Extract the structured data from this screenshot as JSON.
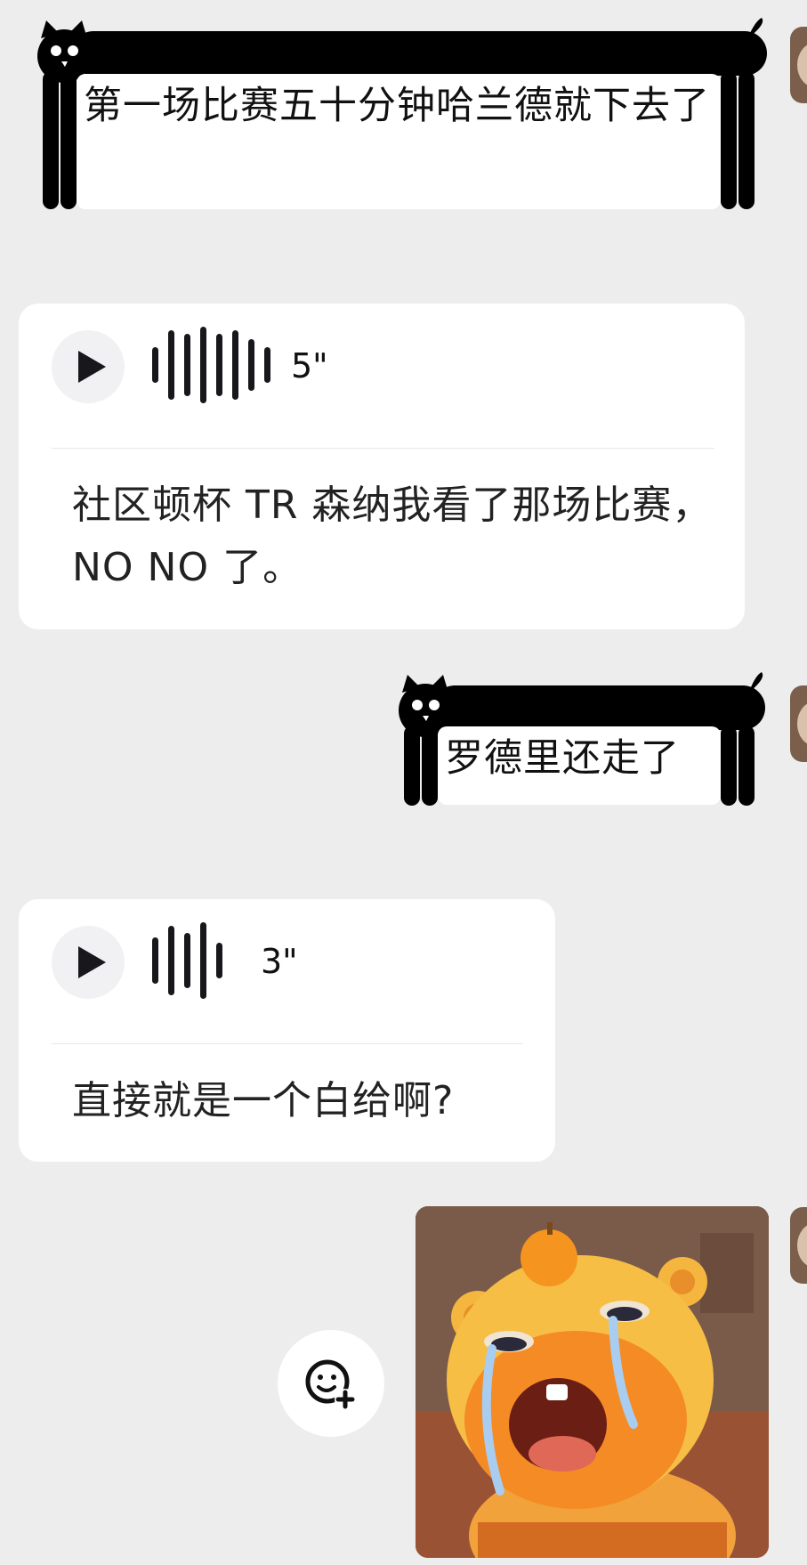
{
  "messages": [
    {
      "side": "right",
      "kind": "text",
      "text": "第一场比赛五十分钟哈兰德就下去了"
    },
    {
      "side": "left",
      "kind": "voice",
      "duration": "5\"",
      "transcript": "社区顿杯 TR 森纳我看了那场比赛，NO NO 了。"
    },
    {
      "side": "right",
      "kind": "text",
      "text": "罗德里还走了"
    },
    {
      "side": "left",
      "kind": "voice",
      "duration": "3\"",
      "transcript": "直接就是一个白给啊?"
    },
    {
      "side": "right",
      "kind": "sticker",
      "icon": "crying-cartoon-bear-sticker"
    }
  ],
  "icons": {
    "play": "play-icon",
    "waveform": "voice-waveform-icon",
    "emoji_add": "add-emoji-icon",
    "bubble_decoration": "black-cat-icon"
  },
  "colors": {
    "background": "#ededed",
    "bubble": "#ffffff",
    "cat": "#000000"
  }
}
